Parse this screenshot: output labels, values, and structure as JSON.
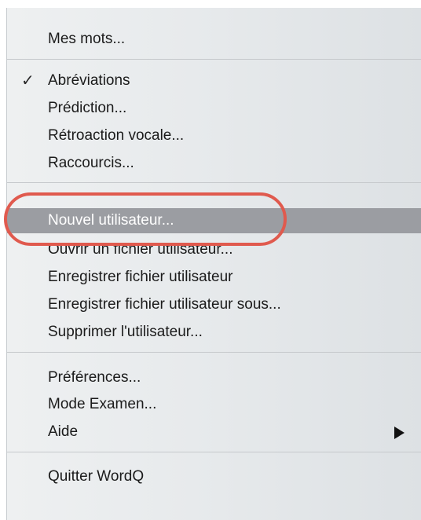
{
  "menu": {
    "items": [
      {
        "label": "Mes mots..."
      },
      {
        "label": "Abréviations",
        "checked": true
      },
      {
        "label": "Prédiction..."
      },
      {
        "label": "Rétroaction vocale..."
      },
      {
        "label": "Raccourcis..."
      },
      {
        "label": "Nouvel utilisateur...",
        "highlighted": true
      },
      {
        "label": "Ouvrir un fichier utilisateur..."
      },
      {
        "label": "Enregistrer fichier utilisateur"
      },
      {
        "label": "Enregistrer fichier utilisateur sous..."
      },
      {
        "label": "Supprimer l'utilisateur..."
      },
      {
        "label": "Préférences..."
      },
      {
        "label": "Mode Examen..."
      },
      {
        "label": "Aide",
        "has_submenu": true
      },
      {
        "label": "Quitter WordQ"
      }
    ],
    "checkmark_glyph": "✓"
  },
  "colors": {
    "highlight": "#9b9da2",
    "annotation": "#e05a4e"
  }
}
